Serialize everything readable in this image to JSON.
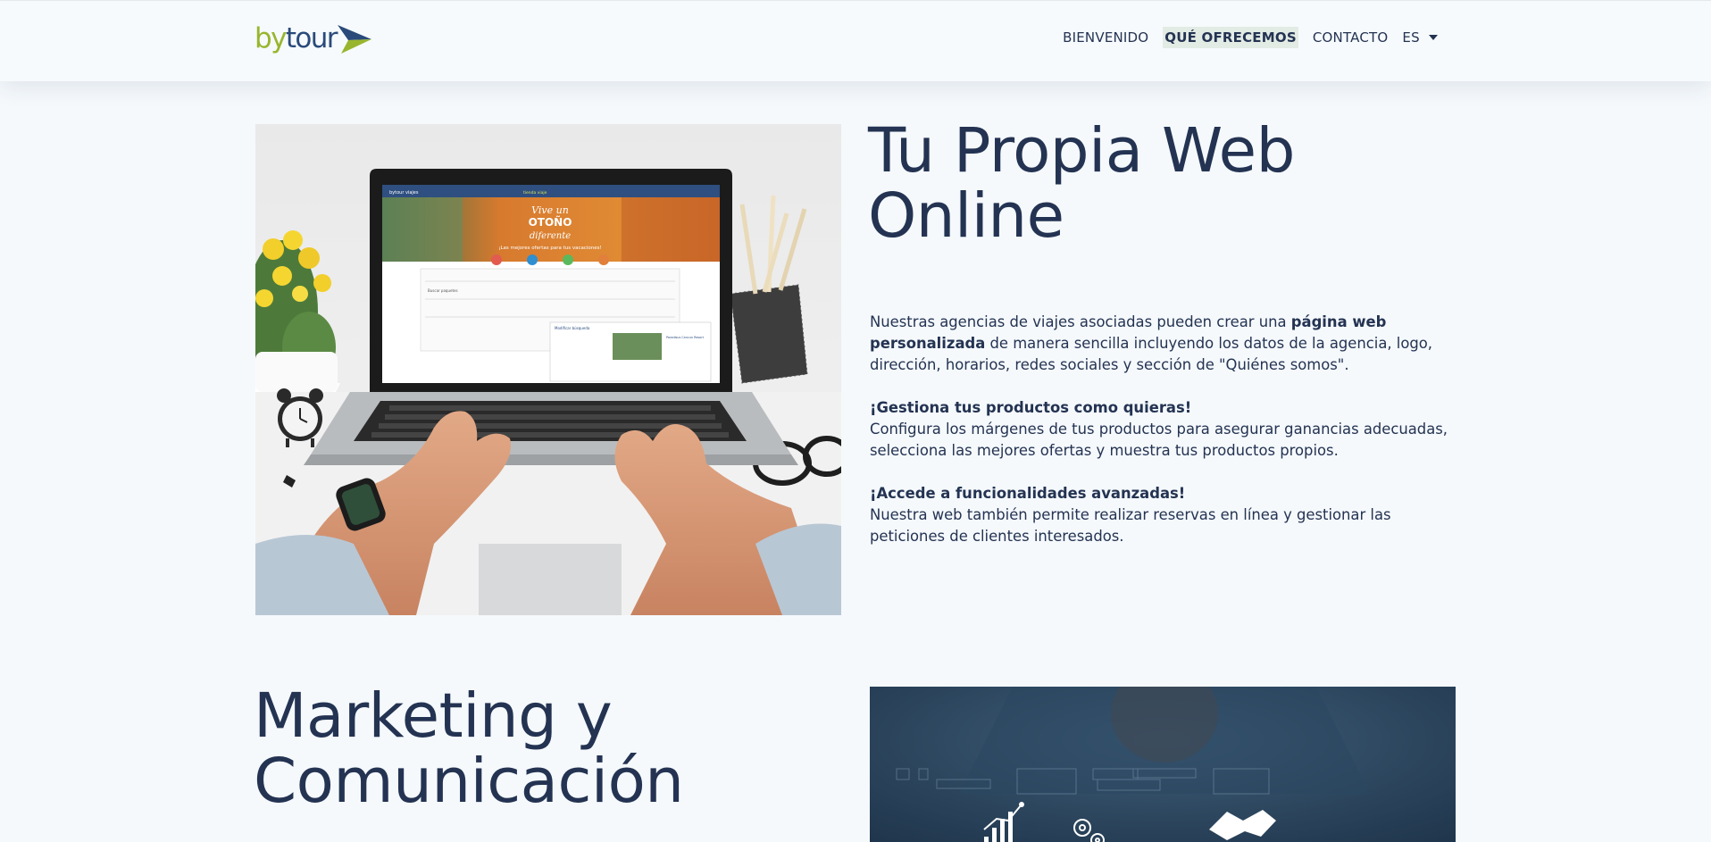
{
  "brand": {
    "logo_by": "by",
    "logo_tour": "tour"
  },
  "nav": {
    "items": [
      "BIENVENIDO",
      "QUÉ OFRECEMOS",
      "CONTACTO"
    ],
    "active_index": 1,
    "language": "ES"
  },
  "section_web": {
    "title_line1": "Tu Propia Web",
    "title_line2": "Online",
    "p1_pre": "Nuestras agencias de viajes asociadas pueden crear una ",
    "p1_bold": "página web personalizada",
    "p1_post": " de manera sencilla incluyendo los datos de la agencia, logo, dirección, horarios, redes sociales y sección de \"Quiénes somos\".",
    "p2_heading": "¡Gestiona tus productos como quieras!",
    "p2_body": "Configura los márgenes de tus productos para asegurar ganancias adecuadas, selecciona las mejores ofertas y muestra tus productos propios.",
    "p3_heading": "¡Accede a funcionalidades avanzadas!",
    "p3_body": "Nuestra web también permite realizar reservas en línea y gestionar las peticiones de clientes interesados.",
    "image_alt": "laptop-typing-photo",
    "screen": {
      "logo": "bytour viajes",
      "brand": "tienda viaje",
      "headline_1": "Vive un",
      "headline_2": "OTOÑO",
      "headline_3": "diferente",
      "tagline": "¡Las mejores ofertas para tus vacaciones!",
      "card_title": "Buscar paquetes",
      "filter_title": "Modificar búsqueda",
      "hotel_name": "Paradisus Cancun Resort"
    }
  },
  "section_marketing": {
    "title_line1": "Marketing y",
    "title_line2": "Comunicación",
    "image_alt": "business-network-photo"
  },
  "colors": {
    "background": "#f5f9fc",
    "text": "#243352",
    "brand_green": "#98b52d",
    "brand_blue": "#2a4a7a",
    "active_bg": "#e3ebe5"
  }
}
